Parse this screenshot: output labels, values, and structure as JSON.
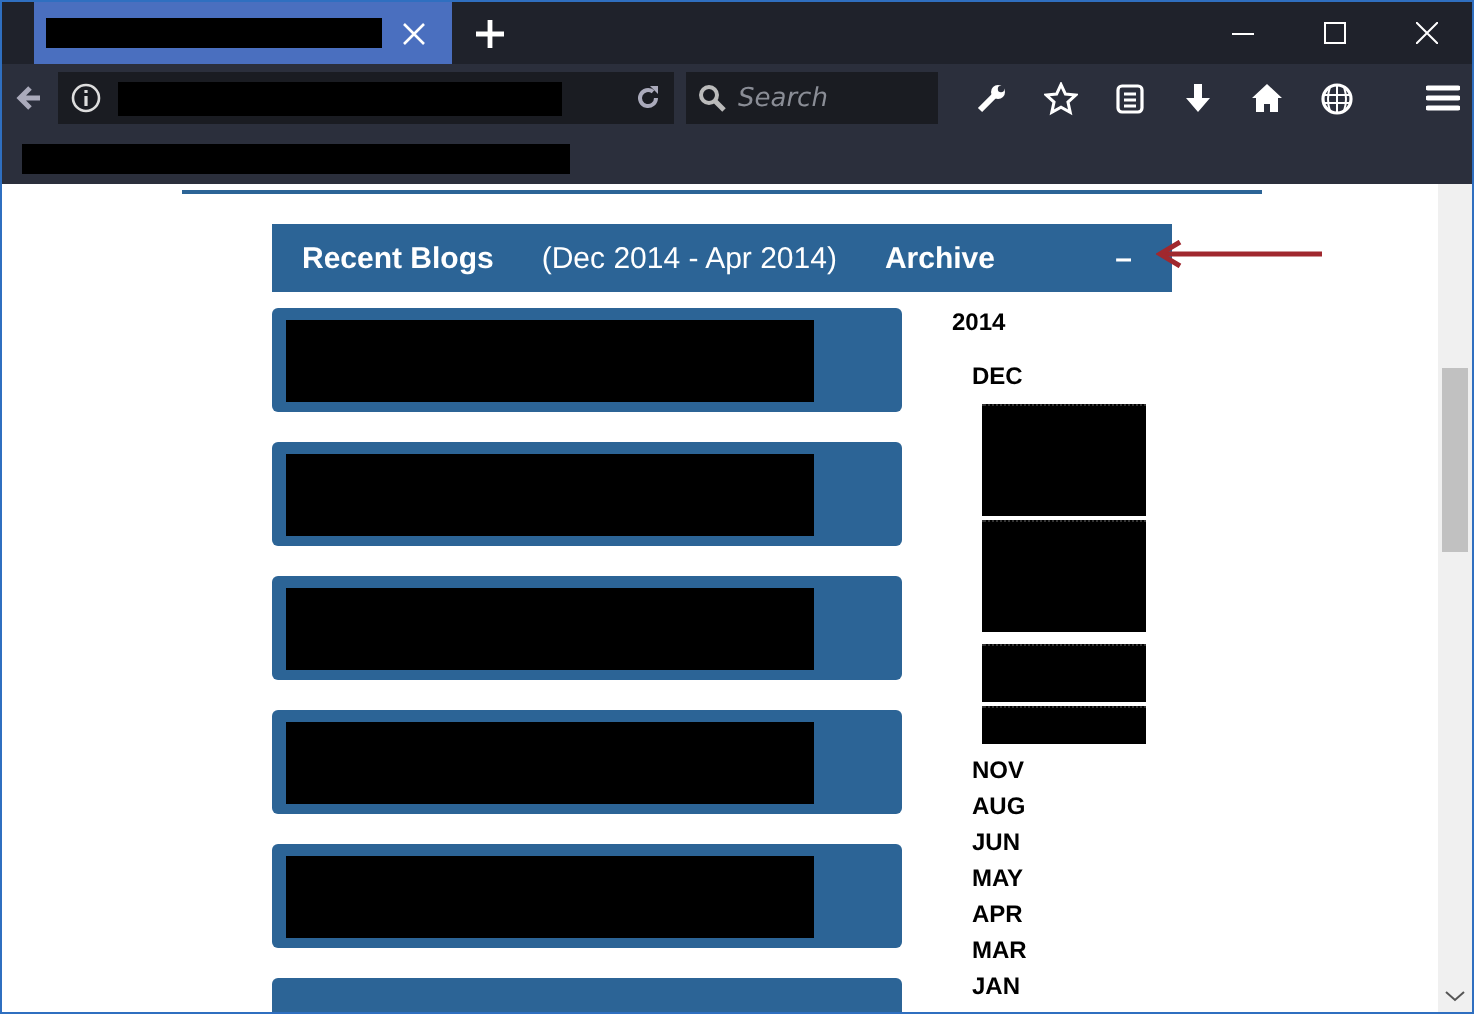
{
  "browser": {
    "tabs": [
      {
        "selected": true
      }
    ],
    "search": {
      "placeholder": "Search"
    }
  },
  "header": {
    "title": "Recent Blogs",
    "range": "(Dec 2014 - Apr 2014)",
    "archive": "Archive",
    "toggle": "–"
  },
  "blog_cards": [
    {
      "kind": "redacted"
    },
    {
      "kind": "redacted"
    },
    {
      "kind": "redacted"
    },
    {
      "kind": "redacted"
    },
    {
      "kind": "redacted"
    },
    {
      "kind": "partial"
    }
  ],
  "archive": {
    "year": "2014",
    "months": [
      {
        "label": "DEC",
        "expanded": true
      },
      {
        "label": "NOV",
        "expanded": false
      },
      {
        "label": "AUG",
        "expanded": false
      },
      {
        "label": "JUN",
        "expanded": false
      },
      {
        "label": "MAY",
        "expanded": false
      },
      {
        "label": "APR",
        "expanded": false
      },
      {
        "label": "MAR",
        "expanded": false
      },
      {
        "label": "JAN",
        "expanded": false
      }
    ]
  }
}
